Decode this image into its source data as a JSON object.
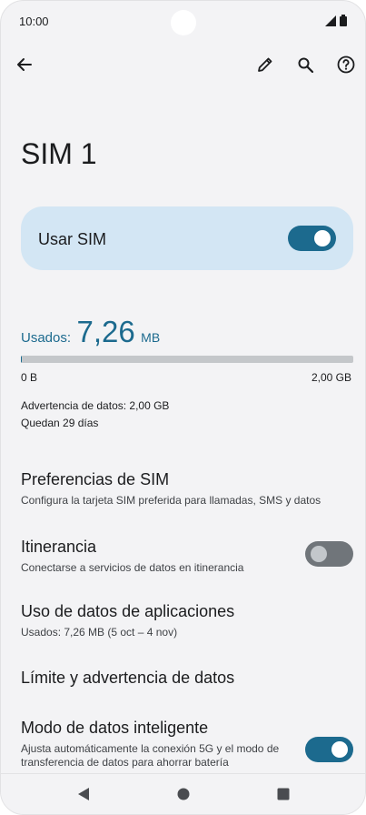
{
  "status_bar": {
    "time": "10:00",
    "signal_icon": "signal-icon",
    "battery_icon": "battery-icon"
  },
  "toolbar": {
    "back_icon": "back-arrow-icon",
    "edit_icon": "pencil-icon",
    "search_icon": "search-icon",
    "help_icon": "help-circle-icon"
  },
  "page": {
    "title": "SIM 1"
  },
  "usar_sim": {
    "label": "Usar SIM",
    "enabled": true
  },
  "usage": {
    "label": "Usados:",
    "value": "7,26",
    "unit": "MB",
    "fraction_used": 0.0036,
    "min_label": "0 B",
    "max_label": "2,00 GB",
    "warning": "Advertencia de datos: 2,00 GB",
    "days_left": "Quedan 29 días"
  },
  "colors": {
    "accent": "#1c6a8e",
    "card_bg": "#d3e6f4",
    "background": "#f3f3f5",
    "toggle_off": "#70757a"
  },
  "preferences": {
    "sim_prefs": {
      "title": "Preferencias de SIM",
      "subtitle": "Configura la tarjeta SIM preferida para llamadas, SMS y datos"
    },
    "roaming": {
      "title": "Itinerancia",
      "subtitle": "Conectarse a servicios de datos en itinerancia",
      "enabled": false
    },
    "app_usage": {
      "title": "Uso de datos de aplicaciones",
      "subtitle": "Usados: 7,26 MB (5 oct – 4 nov)"
    },
    "limit": {
      "title": "Límite y advertencia de datos"
    },
    "smart_mode": {
      "title": "Modo de datos inteligente",
      "subtitle": "Ajusta automáticamente la conexión 5G y el modo de transferencia de datos para ahorrar batería",
      "enabled": true
    }
  },
  "nav_bar": {
    "back_icon": "nav-back-icon",
    "home_icon": "nav-home-icon",
    "recents_icon": "nav-recents-icon"
  }
}
